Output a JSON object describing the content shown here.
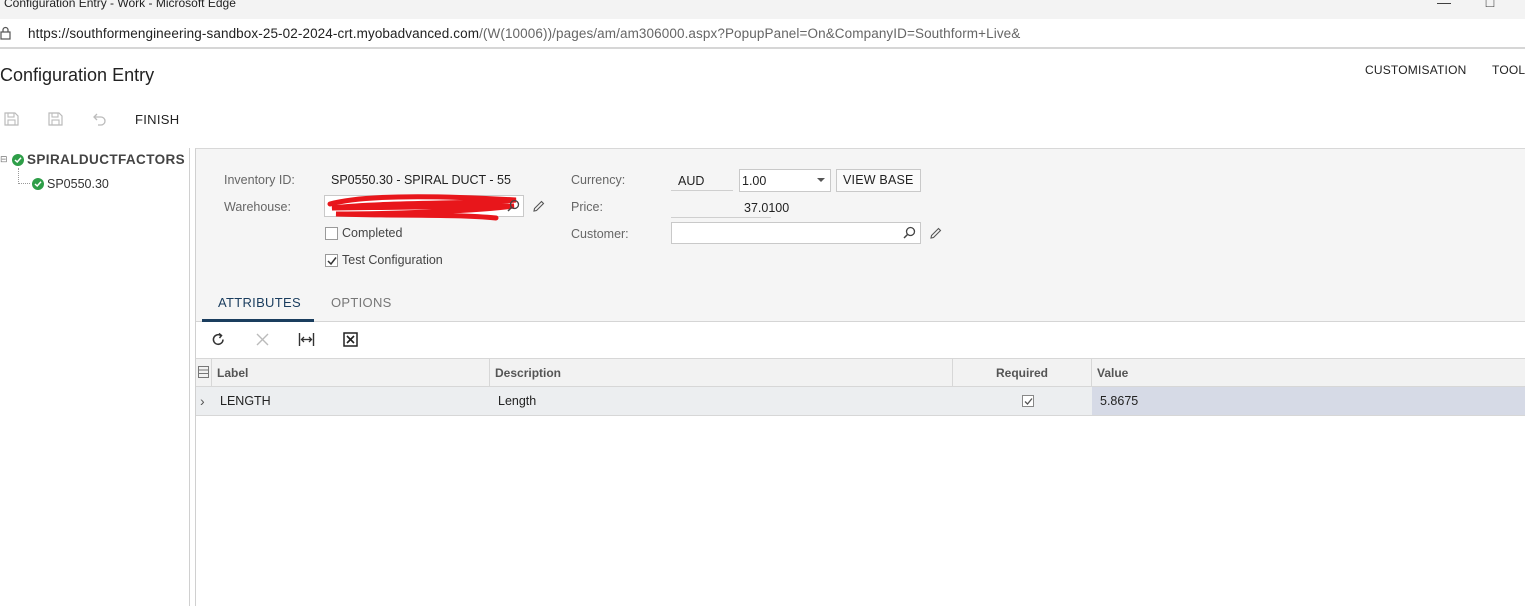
{
  "browser": {
    "window_title": "Configuration Entry - Work - Microsoft Edge",
    "url_host": "https://southformengineering-sandbox-25-02-2024-crt.myobadvanced.com",
    "url_path": "/(W(10006))/pages/am/am306000.aspx?PopupPanel=On&CompanyID=Southform+Live&"
  },
  "header": {
    "page_title": "Configuration Entry",
    "menu": [
      "CUSTOMISATION",
      "TOOL"
    ]
  },
  "toolbar": {
    "finish_label": "FINISH"
  },
  "tree": {
    "root_label": "SPIRALDUCTFACTORS",
    "child_label": "SP0550.30"
  },
  "form": {
    "inventory_id_label": "Inventory ID:",
    "inventory_id_value": "SP0550.30 - SPIRAL DUCT - 55",
    "warehouse_label": "Warehouse:",
    "completed_label": "Completed",
    "completed_checked": false,
    "test_config_label": "Test Configuration",
    "test_config_checked": true,
    "currency_label": "Currency:",
    "currency_value": "AUD",
    "rate_value": "1.00",
    "view_base_label": "VIEW BASE",
    "price_label": "Price:",
    "price_value": "37.0100",
    "customer_label": "Customer:",
    "customer_value": ""
  },
  "tabs": [
    {
      "label": "ATTRIBUTES",
      "active": true
    },
    {
      "label": "OPTIONS",
      "active": false
    }
  ],
  "grid": {
    "columns": [
      "Label",
      "Description",
      "Required",
      "Value"
    ],
    "rows": [
      {
        "label": "LENGTH",
        "description": "Length",
        "required": true,
        "value": "5.8675"
      }
    ]
  },
  "colors": {
    "accent": "#1a3d5e",
    "success": "#2e9e48",
    "redaction": "#e8161b"
  }
}
